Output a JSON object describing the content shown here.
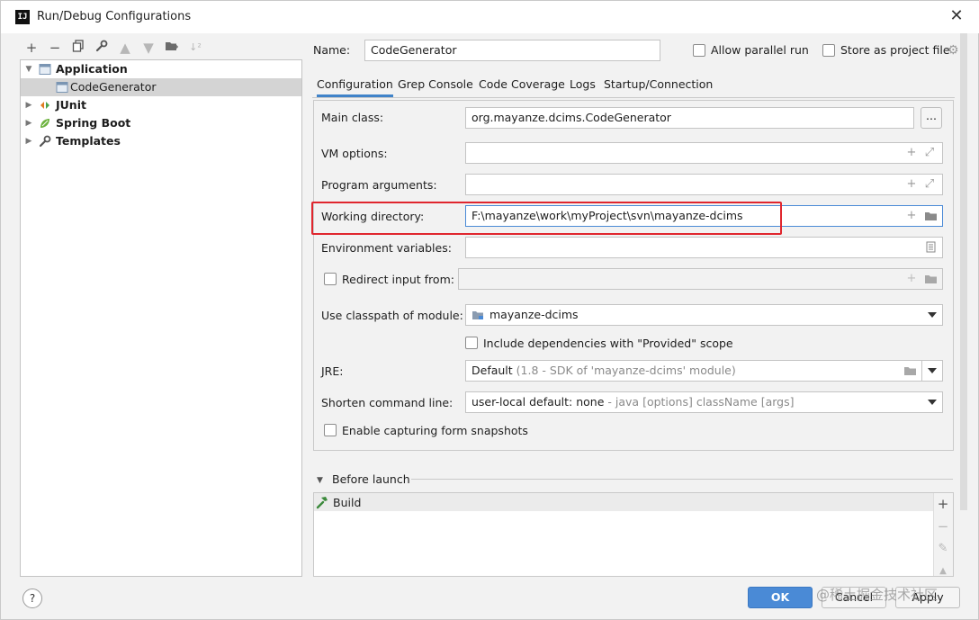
{
  "window": {
    "title": "Run/Debug Configurations",
    "app_icon_text": "IJ",
    "close_glyph": "✕"
  },
  "toolbar": {
    "icons": [
      "add-icon",
      "remove-icon",
      "copy-icon",
      "wrench-icon",
      "move-up-icon",
      "move-down-icon",
      "folder-icon",
      "sort-icon"
    ]
  },
  "tree": {
    "items": [
      {
        "label": "Application",
        "icon": "application-icon",
        "expanded": true,
        "bold": true
      },
      {
        "label": "CodeGenerator",
        "icon": "class-config-icon",
        "selected": true
      },
      {
        "label": "JUnit",
        "icon": "junit-icon",
        "bold": true
      },
      {
        "label": "Spring Boot",
        "icon": "spring-boot-icon",
        "bold": true
      },
      {
        "label": "Templates",
        "icon": "wrench-icon",
        "bold": true
      }
    ]
  },
  "name": {
    "label": "Name:",
    "value": "CodeGenerator"
  },
  "options": {
    "allow_parallel": "Allow parallel run",
    "store_as_project": "Store as project file"
  },
  "tabs": [
    {
      "label": "Configuration",
      "active": true
    },
    {
      "label": "Grep Console"
    },
    {
      "label": "Code Coverage"
    },
    {
      "label": "Logs"
    },
    {
      "label": "Startup/Connection"
    }
  ],
  "form": {
    "main_class": {
      "label": "Main class:",
      "value": "org.mayanze.dcims.CodeGenerator",
      "browse": "..."
    },
    "vm_options": {
      "label": "VM options:",
      "value": ""
    },
    "program_args": {
      "label": "Program arguments:",
      "value": ""
    },
    "working_dir": {
      "label": "Working directory:",
      "value": "F:\\mayanze\\work\\myProject\\svn\\mayanze-dcims"
    },
    "env_vars": {
      "label": "Environment variables:",
      "value": ""
    },
    "redirect_input": {
      "label": "Redirect input from:",
      "value": ""
    },
    "classpath_module": {
      "label": "Use classpath of module:",
      "value": "mayanze-dcims"
    },
    "include_provided": {
      "label": "Include dependencies with \"Provided\" scope"
    },
    "jre": {
      "label": "JRE:",
      "value_main": "Default",
      "value_hint": "(1.8 - SDK of 'mayanze-dcims' module)"
    },
    "shorten_cmd": {
      "label": "Shorten command line:",
      "value_main": "user-local default: none",
      "value_hint": "- java [options] className [args]"
    },
    "form_snapshots": {
      "label": "Enable capturing form snapshots"
    }
  },
  "before_launch": {
    "label": "Before launch",
    "items": [
      {
        "label": "Build",
        "icon": "hammer-icon"
      }
    ]
  },
  "buttons": {
    "ok": "OK",
    "cancel": "Cancel",
    "apply": "Apply",
    "help": "?"
  },
  "watermark": "@稀土掘金技术社区",
  "colors": {
    "accent": "#4a8ad6",
    "tab_underline": "#4083c9",
    "highlight_box": "#e0262e"
  }
}
